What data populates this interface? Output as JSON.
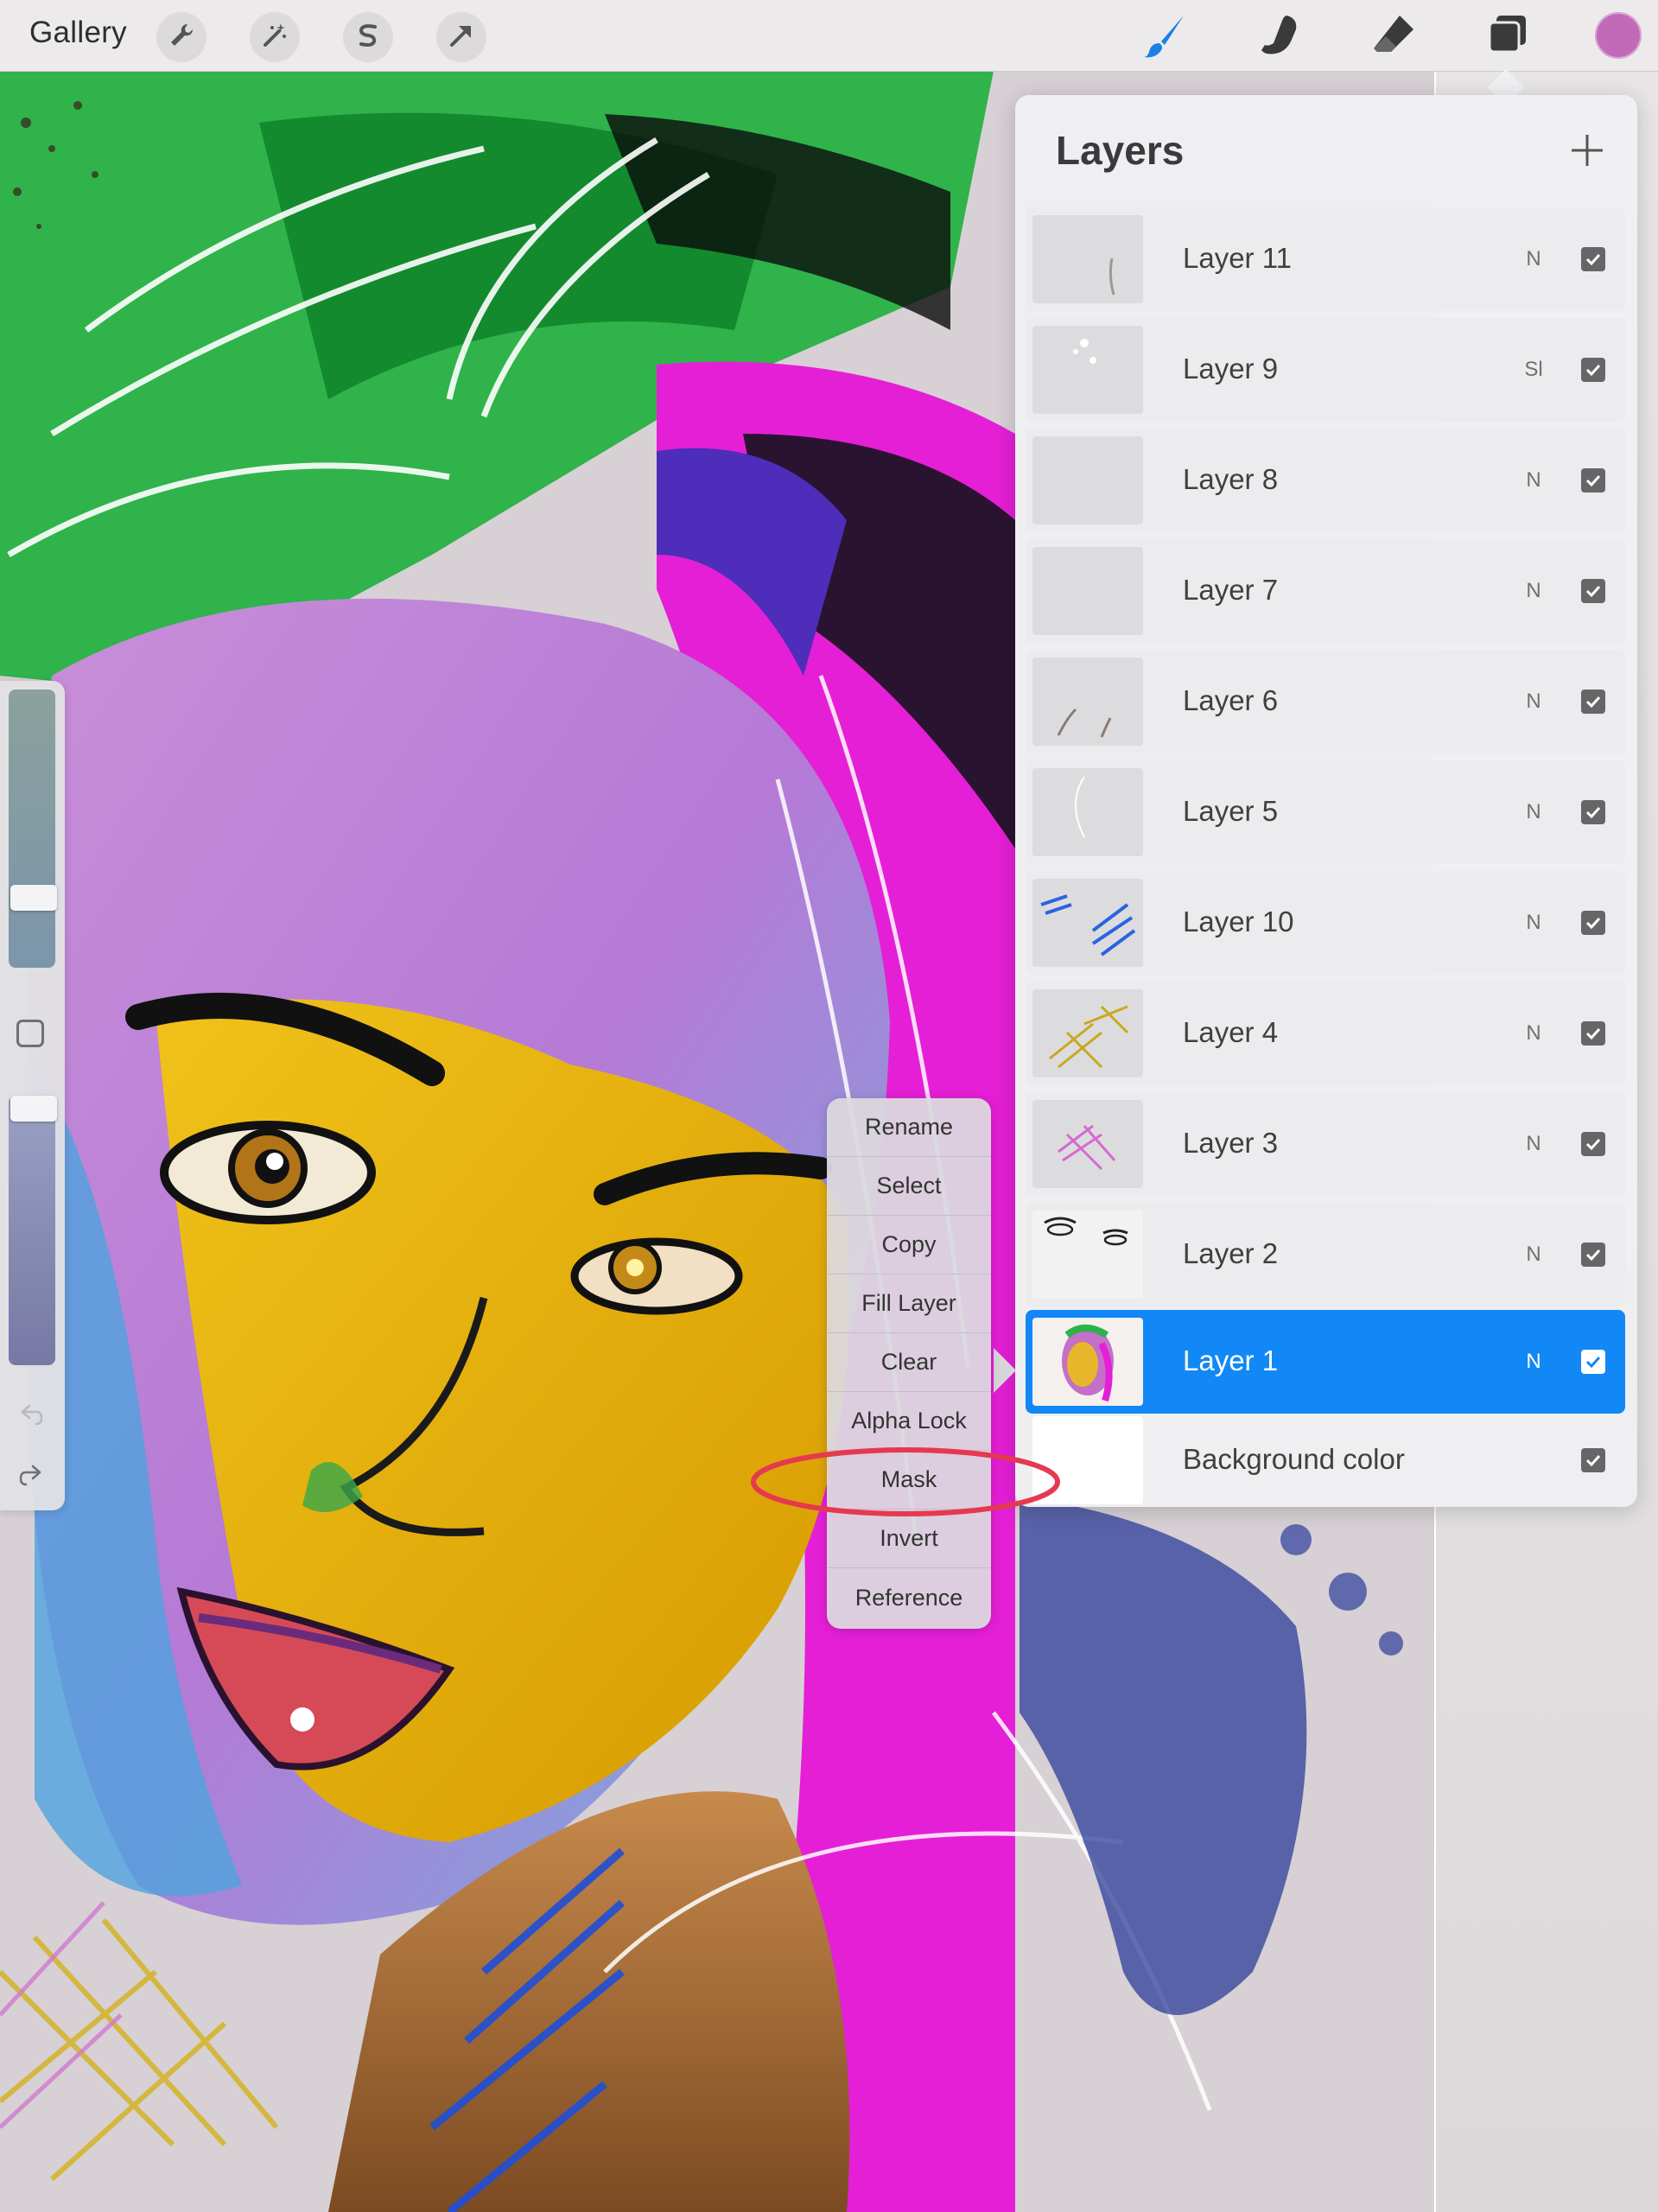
{
  "toolbar": {
    "gallery_label": "Gallery",
    "left_tools": [
      {
        "name": "actions",
        "icon": "wrench-icon"
      },
      {
        "name": "adjustments",
        "icon": "magic-wand-icon"
      },
      {
        "name": "selection",
        "icon": "selection-s-icon"
      },
      {
        "name": "transform",
        "icon": "arrow-cursor-icon"
      }
    ],
    "right_tools": [
      {
        "name": "paint",
        "icon": "brush-icon",
        "active": true
      },
      {
        "name": "smudge",
        "icon": "smudge-finger-icon"
      },
      {
        "name": "erase",
        "icon": "eraser-icon"
      },
      {
        "name": "layers",
        "icon": "layers-icon"
      }
    ],
    "current_color": "#c16ab8"
  },
  "layers_panel": {
    "title": "Layers",
    "add_icon": "plus-icon",
    "layers": [
      {
        "name": "Layer 11",
        "blend": "N",
        "visible": true
      },
      {
        "name": "Layer 9",
        "blend": "Sl",
        "visible": true
      },
      {
        "name": "Layer 8",
        "blend": "N",
        "visible": true
      },
      {
        "name": "Layer 7",
        "blend": "N",
        "visible": true
      },
      {
        "name": "Layer 6",
        "blend": "N",
        "visible": true
      },
      {
        "name": "Layer 5",
        "blend": "N",
        "visible": true
      },
      {
        "name": "Layer 10",
        "blend": "N",
        "visible": true
      },
      {
        "name": "Layer 4",
        "blend": "N",
        "visible": true
      },
      {
        "name": "Layer 3",
        "blend": "N",
        "visible": true
      },
      {
        "name": "Layer 2",
        "blend": "N",
        "visible": true
      },
      {
        "name": "Layer 1",
        "blend": "N",
        "visible": true,
        "selected": true
      },
      {
        "name": "Background color",
        "blend": "",
        "visible": true
      }
    ],
    "selected_color": "#1188f5"
  },
  "context_menu": {
    "items": [
      "Rename",
      "Select",
      "Copy",
      "Fill Layer",
      "Clear",
      "Alpha Lock",
      "Mask",
      "Invert",
      "Reference"
    ],
    "highlighted_item": "Mask",
    "highlight_color": "#e53950"
  },
  "sidebar": {
    "brush_size_icon": "brush-size-slider",
    "modify_icon": "square-modify-icon",
    "opacity_icon": "opacity-slider",
    "undo_icon": "undo-arrow-icon",
    "redo_icon": "redo-arrow-icon"
  }
}
